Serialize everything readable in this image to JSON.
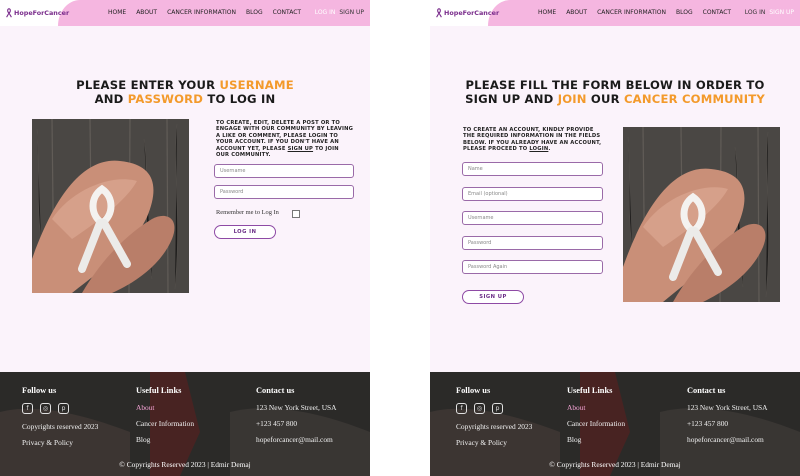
{
  "site": {
    "logo_text": "HopeForCancer",
    "nav": [
      "HOME",
      "ABOUT",
      "CANCER INFORMATION",
      "BLOG",
      "CONTACT"
    ],
    "login_label": "LOG IN",
    "signup_label": "SIGN UP"
  },
  "login_page": {
    "title_line1_prefix": "PLEASE ENTER YOUR ",
    "title_line1_highlight": "USERNAME",
    "title_line2_prefix": "AND ",
    "title_line2_highlight": "PASSWORD",
    "title_line2_suffix": " TO LOG IN",
    "info_text": "TO CREATE, EDIT, DELETE A POST OR TO ENGAGE WITH OUR COMMUNITY BY LEAVING A LIKE OR COMMENT, PLEASE LOGIN TO YOUR ACCOUNT. IF YOU DON'T HAVE AN ACCOUNT YET, PLEASE ",
    "info_link": "SIGN UP",
    "info_suffix": " TO JOIN OUR COMMUNITY.",
    "username_placeholder": "Username",
    "password_placeholder": "Password",
    "remember_label": "Remember me to Log In",
    "button_label": "LOG IN"
  },
  "signup_page": {
    "title_line1": "PLEASE FILL THE FORM BELOW IN ORDER TO",
    "title_line2_prefix": "SIGN UP AND ",
    "title_line2_highlight1": "JOIN",
    "title_line2_mid": " OUR ",
    "title_line2_highlight2": "CANCER COMMUNITY",
    "info_text": "TO CREATE AN ACCOUNT, KINDLY PROVIDE THE REQUIRED INFORMATION IN THE FIELDS BELOW. IF YOU ALREADY HAVE AN ACCOUNT, PLEASE PROCEED TO ",
    "info_link": "LOGIN",
    "info_suffix": ".",
    "name_placeholder": "Name",
    "email_placeholder": "Email (optional)",
    "username_placeholder": "Username",
    "password_placeholder": "Password",
    "password_again_placeholder": "Password Again",
    "button_label": "SIGN UP"
  },
  "footer": {
    "follow_title": "Follow us",
    "social_icons": [
      "facebook-icon",
      "instagram-icon",
      "pinterest-icon"
    ],
    "copyrights_reserved": "Copyrights reserved 2023",
    "privacy": "Privacy & Policy",
    "links_title": "Useful Links",
    "links": [
      "About",
      "Cancer Information",
      "Blog"
    ],
    "contact_title": "Contact us",
    "address": "123 New York Street, USA",
    "phone": "+123 457 800",
    "email": "hopeforcancer@mail.com",
    "copyright_line": "Copyrights Reserved 2023 | Edmir Demaj"
  },
  "colors": {
    "accent_orange": "#f39a2b",
    "header_pink": "#f5b6e0",
    "brand_purple": "#7a2d8c",
    "page_bg": "#fbf3fb"
  }
}
